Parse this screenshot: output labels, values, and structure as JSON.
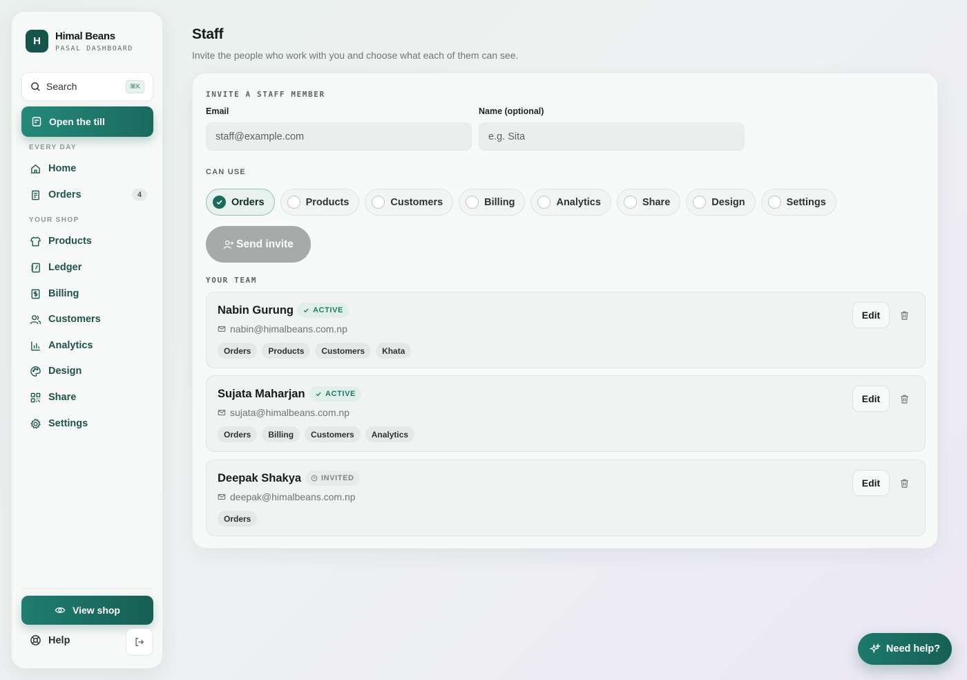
{
  "brand": {
    "initial": "H",
    "name": "Himal Beans",
    "subtitle": "PASAL DASHBOARD"
  },
  "search": {
    "label": "Search",
    "shortcut": "⌘K"
  },
  "till_button": "Open the till",
  "sections": {
    "every_day": "EVERY DAY",
    "your_shop": "YOUR SHOP"
  },
  "nav": {
    "home": "Home",
    "orders": "Orders",
    "orders_count": "4",
    "products": "Products",
    "ledger": "Ledger",
    "billing": "Billing",
    "customers": "Customers",
    "analytics": "Analytics",
    "design": "Design",
    "share": "Share",
    "settings": "Settings"
  },
  "footer": {
    "view_shop": "View shop",
    "help": "Help"
  },
  "page": {
    "title": "Staff",
    "subtitle": "Invite the people who work with you and choose what each of them can see."
  },
  "invite": {
    "section_label": "INVITE A STAFF MEMBER",
    "email_label": "Email",
    "email_placeholder": "staff@example.com",
    "name_label": "Name (optional)",
    "name_placeholder": "e.g. Sita",
    "can_use_label": "CAN USE",
    "permissions": [
      {
        "label": "Orders",
        "checked": true
      },
      {
        "label": "Products",
        "checked": false
      },
      {
        "label": "Customers",
        "checked": false
      },
      {
        "label": "Billing",
        "checked": false
      },
      {
        "label": "Analytics",
        "checked": false
      },
      {
        "label": "Share",
        "checked": false
      },
      {
        "label": "Design",
        "checked": false
      },
      {
        "label": "Settings",
        "checked": false
      }
    ],
    "send_button": "Send invite"
  },
  "team": {
    "section_label": "YOUR TEAM",
    "edit_label": "Edit",
    "members": [
      {
        "name": "Nabin Gurung",
        "status": "ACTIVE",
        "email": "nabin@himalbeans.com.np",
        "tags": [
          "Orders",
          "Products",
          "Customers",
          "Khata"
        ]
      },
      {
        "name": "Sujata Maharjan",
        "status": "ACTIVE",
        "email": "sujata@himalbeans.com.np",
        "tags": [
          "Orders",
          "Billing",
          "Customers",
          "Analytics"
        ]
      },
      {
        "name": "Deepak Shakya",
        "status": "INVITED",
        "email": "deepak@himalbeans.com.np",
        "tags": [
          "Orders"
        ]
      }
    ]
  },
  "help_fab": "Need help?",
  "colors": {
    "accent": "#1a6a5e",
    "accent_light": "#24897a",
    "active_status": "#1d7a68",
    "disabled_button": "#a6aaa9"
  }
}
